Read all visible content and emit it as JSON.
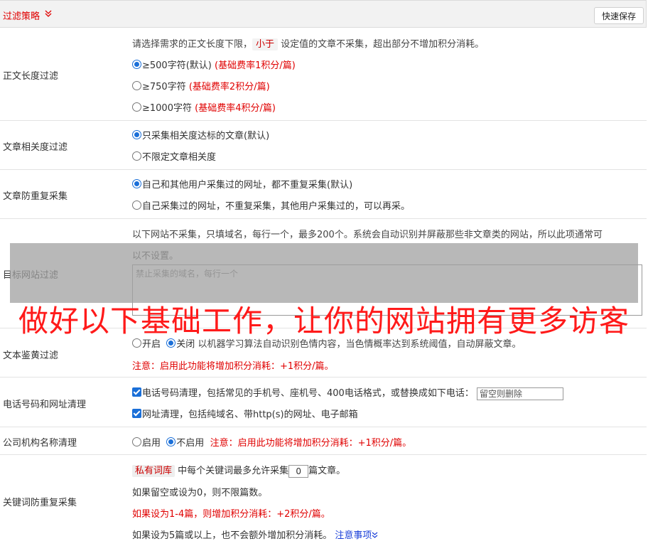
{
  "header": {
    "title": "过滤策略",
    "save_label": "快速保存"
  },
  "length_filter": {
    "label": "正文长度过滤",
    "desc_prefix": "请选择需求的正文长度下限，",
    "desc_tag": "小于",
    "desc_suffix": "设定值的文章不采集，超出部分不增加积分消耗。",
    "options": [
      {
        "text": "≥500字符(默认)",
        "note": "(基础费率1积分/篇)",
        "checked": true
      },
      {
        "text": "≥750字符",
        "note": "(基础费率2积分/篇)",
        "checked": false
      },
      {
        "text": "≥1000字符",
        "note": "(基础费率4积分/篇)",
        "checked": false
      }
    ]
  },
  "relevance": {
    "label": "文章相关度过滤",
    "options": [
      {
        "text": "只采集相关度达标的文章(默认)",
        "checked": true
      },
      {
        "text": "不限定文章相关度",
        "checked": false
      }
    ]
  },
  "dedupe": {
    "label": "文章防重复采集",
    "options": [
      {
        "text": "自己和其他用户采集过的网址，都不重复采集(默认)",
        "checked": true
      },
      {
        "text": "自己采集过的网址，不重复采集，其他用户采集过的，可以再采。",
        "checked": false
      }
    ]
  },
  "site_filter": {
    "label": "目标网站过滤",
    "desc_line1": "以下网站不采集，只填域名，每行一个，最多200个。系统会自动识别并屏蔽那些非文章类的网站，所以此项通常可",
    "desc_line2": "以不设置。",
    "placeholder": "禁止采集的域名，每行一个"
  },
  "banner": "做好以下基础工作，让你的网站拥有更多访客",
  "porn_filter": {
    "label": "文本鉴黄过滤",
    "on_label": "开启",
    "off_label": "关闭",
    "on_checked": false,
    "off_checked": true,
    "desc": "以机器学习算法自动识别色情内容，当色情概率达到系统阈值，自动屏蔽文章。",
    "note": "注意：启用此功能将增加积分消耗：+1积分/篇。"
  },
  "phone_url": {
    "label": "电话号码和网址清理",
    "phone_text": "电话号码清理，包括常见的手机号、座机号、400电话格式，或替换成如下电话：",
    "phone_placeholder": "留空则删除",
    "phone_checked": true,
    "url_text": "网址清理，包括纯域名、带http(s)的网址、电子邮箱",
    "url_checked": true
  },
  "company": {
    "label": "公司机构名称清理",
    "on_label": "启用",
    "off_label": "不启用",
    "on_checked": false,
    "off_checked": true,
    "note": "注意：启用此功能将增加积分消耗：+1积分/篇。"
  },
  "keyword_dedupe": {
    "label": "关键词防重复采集",
    "tag": "私有词库",
    "line1_mid": "中每个关键词最多允许采集",
    "count": "0",
    "line1_end": "篇文章。",
    "line2": "如果留空或设为0，则不限篇数。",
    "line3": "如果设为1-4篇，则增加积分消耗：+2积分/篇。",
    "line4": "如果设为5篇或以上，也不会额外增加积分消耗。",
    "link": "注意事项"
  },
  "colors": {
    "accent": "#1a6fd8",
    "warning": "#e00000",
    "banner": "#ff1a1a"
  }
}
